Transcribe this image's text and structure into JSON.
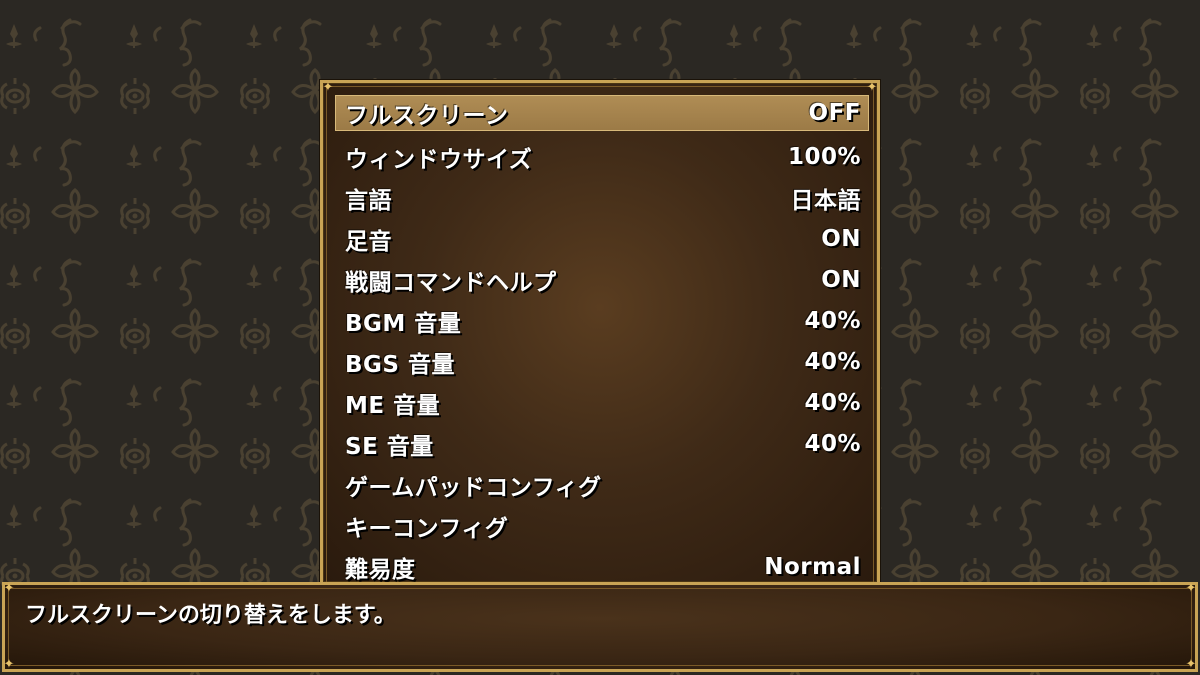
{
  "colors": {
    "background": "#2b2823",
    "pattern": "#4a4131",
    "frame_gold": "#c9a455",
    "selection": "#a6834d",
    "text": "#ffffff"
  },
  "options": {
    "items": [
      {
        "label": "フルスクリーン",
        "value": "OFF",
        "selected": true
      },
      {
        "label": "ウィンドウサイズ",
        "value": "100%"
      },
      {
        "label": "言語",
        "value": "日本語"
      },
      {
        "label": "足音",
        "value": "ON"
      },
      {
        "label": "戦闘コマンドヘルプ",
        "value": "ON"
      },
      {
        "label": "BGM 音量",
        "value": "40%"
      },
      {
        "label": "BGS 音量",
        "value": "40%"
      },
      {
        "label": "ME 音量",
        "value": "40%"
      },
      {
        "label": "SE 音量",
        "value": "40%"
      },
      {
        "label": "ゲームパッドコンフィグ",
        "value": ""
      },
      {
        "label": "キーコンフィグ",
        "value": ""
      },
      {
        "label": "難易度",
        "value": "Normal"
      }
    ]
  },
  "help": {
    "text": "フルスクリーンの切り替えをします。"
  },
  "decorations": {
    "corner_icon": "ornament-corner-icon",
    "pattern_icon": "damask-ornament-icon"
  }
}
